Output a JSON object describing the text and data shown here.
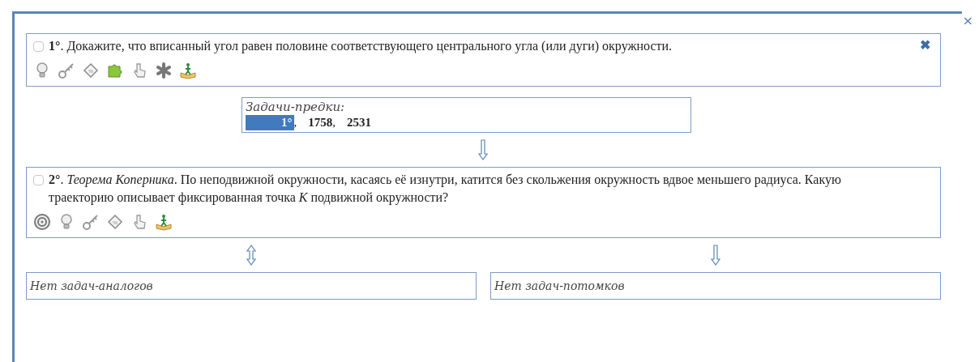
{
  "close_label": "×",
  "problems": [
    {
      "checked": false,
      "text": "**1°**. Докажите, что вписанный угол равен половине соответствующего центрального угла (или дуги) окружности.",
      "remove_label": "✖",
      "icons": [
        {
          "kind": "bulb"
        },
        {
          "kind": "key"
        },
        {
          "kind": "tag"
        },
        {
          "kind": "puzzle"
        },
        {
          "kind": "hand"
        },
        {
          "kind": "asterisk"
        },
        {
          "kind": "book"
        }
      ]
    },
    {
      "checked": false,
      "text": "**2°**. *Теорема Коперника*. По неподвижной окружности, касаясь её изнутри, катится без скольжения окружность вдвое меньшего радиуса. Какую траекторию описывает фиксированная точка *K* подвижной окружности?",
      "icons": [
        {
          "kind": "target"
        },
        {
          "kind": "bulb"
        },
        {
          "kind": "key"
        },
        {
          "kind": "tag"
        },
        {
          "kind": "hand"
        },
        {
          "kind": "book"
        }
      ]
    }
  ],
  "ancestors": {
    "title": "Задачи-предки:",
    "items": [
      {
        "label": "1°",
        "separator": ",",
        "selected": true
      },
      {
        "label": "1758",
        "separator": ",",
        "selected": false
      },
      {
        "label": "2531",
        "selected": false
      }
    ]
  },
  "arrow_down": {
    "kind": "down"
  },
  "related": [
    {
      "arrow": {
        "kind": "updown"
      },
      "text": "Нет задач-аналогов"
    },
    {
      "arrow": {
        "kind": "down"
      },
      "text": "Нет задач-потомков"
    }
  ]
}
